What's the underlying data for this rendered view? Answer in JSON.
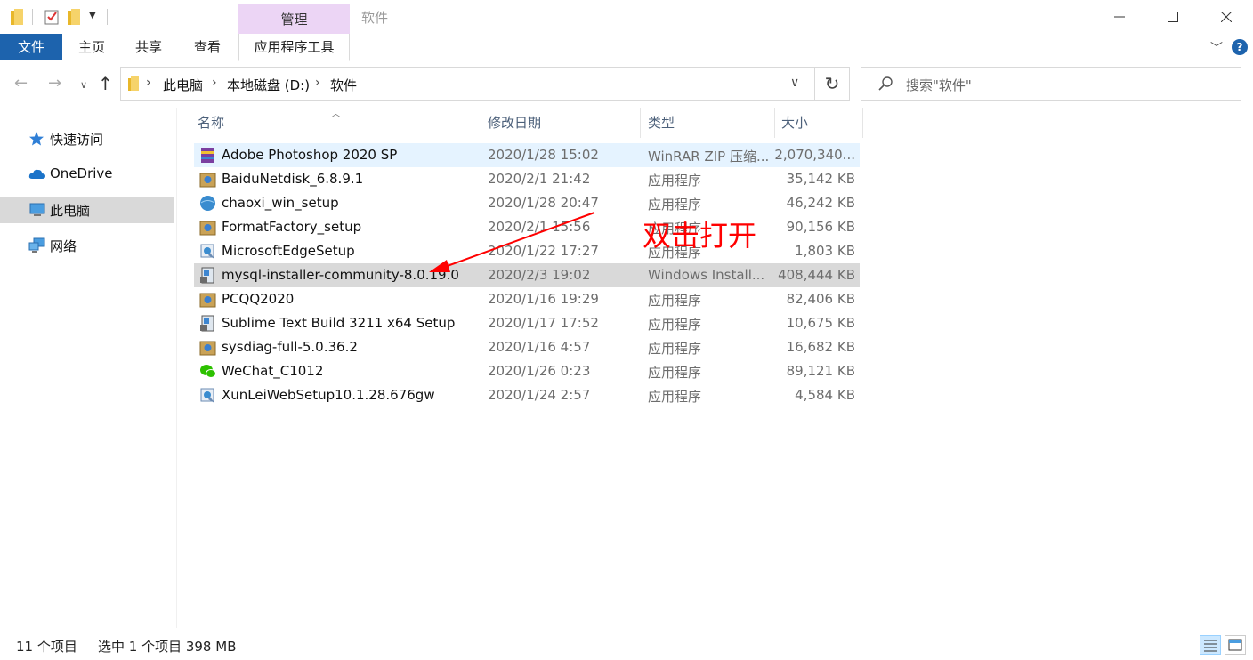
{
  "titlebar": {
    "manage_tab": "管理",
    "window_title": "软件",
    "minimize": "—",
    "maximize": "☐",
    "close": "✕"
  },
  "ribbon": {
    "file": "文件",
    "home": "主页",
    "share": "共享",
    "view": "查看",
    "app_tools": "应用程序工具",
    "help": "?"
  },
  "address": {
    "crumbs": [
      "此电脑",
      "本地磁盘 (D:)",
      "软件"
    ],
    "search_placeholder": "搜索\"软件\""
  },
  "sidebar": {
    "items": [
      {
        "label": "快速访问",
        "icon": "star-icon"
      },
      {
        "label": "OneDrive",
        "icon": "cloud-icon"
      },
      {
        "label": "此电脑",
        "icon": "computer-icon",
        "selected": true
      },
      {
        "label": "网络",
        "icon": "network-icon"
      }
    ]
  },
  "columns": {
    "name": "名称",
    "date": "修改日期",
    "type": "类型",
    "size": "大小"
  },
  "files": [
    {
      "name": "Adobe Photoshop 2020 SP",
      "date": "2020/1/28 15:02",
      "type": "WinRAR ZIP 压缩...",
      "size": "2,070,340...",
      "icon": "winrar-icon"
    },
    {
      "name": "BaiduNetdisk_6.8.9.1",
      "date": "2020/2/1 21:42",
      "type": "应用程序",
      "size": "35,142 KB",
      "icon": "installer-box-icon"
    },
    {
      "name": "chaoxi_win_setup",
      "date": "2020/1/28 20:47",
      "type": "应用程序",
      "size": "46,242 KB",
      "icon": "globe-icon"
    },
    {
      "name": "FormatFactory_setup",
      "date": "2020/2/1 15:56",
      "type": "应用程序",
      "size": "90,156 KB",
      "icon": "installer-box-icon"
    },
    {
      "name": "MicrosoftEdgeSetup",
      "date": "2020/1/22 17:27",
      "type": "应用程序",
      "size": "1,803 KB",
      "icon": "setup-icon"
    },
    {
      "name": "mysql-installer-community-8.0.19.0",
      "date": "2020/2/3 19:02",
      "type": "Windows Install...",
      "size": "408,444 KB",
      "icon": "msi-icon"
    },
    {
      "name": "PCQQ2020",
      "date": "2020/1/16 19:29",
      "type": "应用程序",
      "size": "82,406 KB",
      "icon": "installer-box-icon"
    },
    {
      "name": "Sublime Text Build 3211 x64 Setup",
      "date": "2020/1/17 17:52",
      "type": "应用程序",
      "size": "10,675 KB",
      "icon": "msi-icon"
    },
    {
      "name": "sysdiag-full-5.0.36.2",
      "date": "2020/1/16 4:57",
      "type": "应用程序",
      "size": "16,682 KB",
      "icon": "installer-box-icon"
    },
    {
      "name": "WeChat_C1012",
      "date": "2020/1/26 0:23",
      "type": "应用程序",
      "size": "89,121 KB",
      "icon": "wechat-icon"
    },
    {
      "name": "XunLeiWebSetup10.1.28.676gw",
      "date": "2020/1/24 2:57",
      "type": "应用程序",
      "size": "4,584 KB",
      "icon": "setup-icon"
    }
  ],
  "annotation": {
    "text": "双击打开",
    "color": "#ff0000"
  },
  "status": {
    "count": "11 个项目",
    "selection": "选中 1 个项目  398 MB"
  },
  "colors": {
    "file_tab": "#1d63ad",
    "manage_tab": "#ecd5f5",
    "row_hover": "#e5f3ff",
    "row_selected": "#d9d9d9"
  }
}
